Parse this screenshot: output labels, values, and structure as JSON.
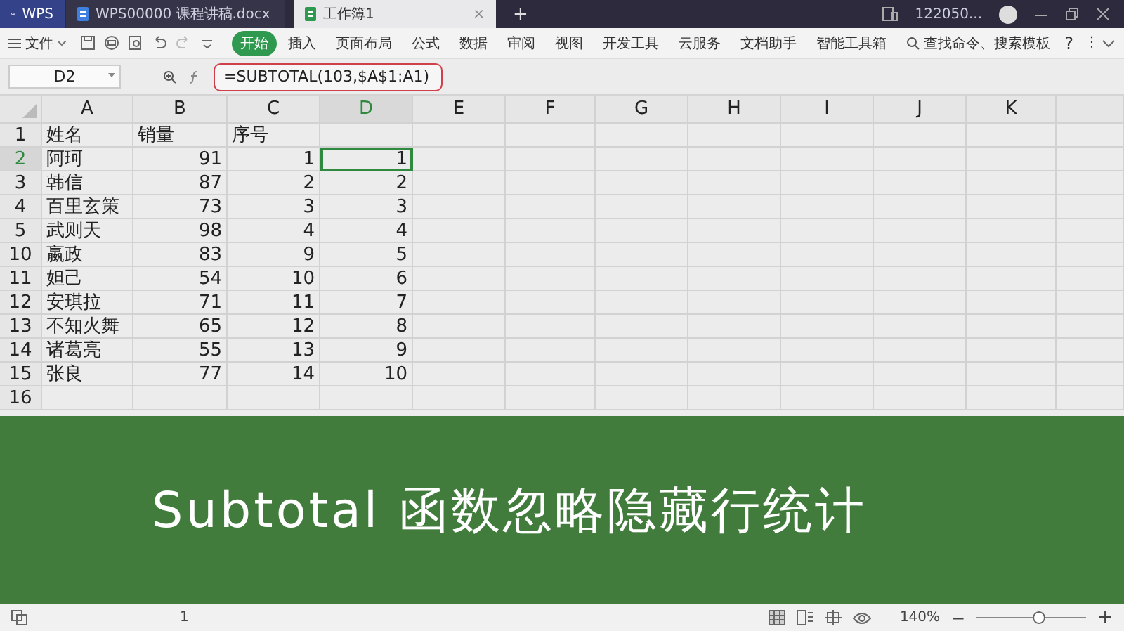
{
  "title_bar": {
    "app_tab": "WPS",
    "tabs": [
      {
        "label": "WPS00000 课程讲稿.docx",
        "kind": "doc",
        "selected": false
      },
      {
        "label": "工作簿1",
        "kind": "sheet",
        "selected": true,
        "close": "×"
      }
    ],
    "new_tab": "+",
    "user": "122050..."
  },
  "ribbon": {
    "file_menu": "文件",
    "tabs": [
      {
        "label": "开始",
        "selected": true
      },
      {
        "label": "插入",
        "selected": false
      },
      {
        "label": "页面布局",
        "selected": false
      },
      {
        "label": "公式",
        "selected": false
      },
      {
        "label": "数据",
        "selected": false
      },
      {
        "label": "审阅",
        "selected": false
      },
      {
        "label": "视图",
        "selected": false
      },
      {
        "label": "开发工具",
        "selected": false
      },
      {
        "label": "云服务",
        "selected": false
      },
      {
        "label": "文档助手",
        "selected": false
      },
      {
        "label": "智能工具箱",
        "selected": false
      }
    ],
    "search": "查找命令、搜索模板",
    "help": "?",
    "more": "⋮"
  },
  "formula_bar": {
    "name_box": "D2",
    "formula": "=SUBTOTAL(103,$A$1:A1)",
    "highlighted": true
  },
  "sheet": {
    "columns": [
      {
        "label": "A",
        "selected": false
      },
      {
        "label": "B",
        "selected": false
      },
      {
        "label": "C",
        "selected": false
      },
      {
        "label": "D",
        "selected": true
      },
      {
        "label": "E",
        "selected": false
      },
      {
        "label": "F",
        "selected": false
      },
      {
        "label": "G",
        "selected": false
      },
      {
        "label": "H",
        "selected": false
      },
      {
        "label": "I",
        "selected": false
      },
      {
        "label": "J",
        "selected": false
      },
      {
        "label": "K",
        "selected": false
      }
    ],
    "rows": [
      {
        "number": "1",
        "selected": false,
        "cells": [
          "姓名",
          "销量",
          "序号"
        ]
      },
      {
        "number": "2",
        "selected": true,
        "cells": [
          "阿珂",
          "91",
          "1",
          "1"
        ]
      },
      {
        "number": "3",
        "selected": false,
        "cells": [
          "韩信",
          "87",
          "2",
          "2"
        ]
      },
      {
        "number": "4",
        "selected": false,
        "cells": [
          "百里玄策",
          "73",
          "3",
          "3"
        ]
      },
      {
        "number": "5",
        "selected": false,
        "cells": [
          "武则天",
          "98",
          "4",
          "4"
        ]
      },
      {
        "number": "10",
        "selected": false,
        "cells": [
          "嬴政",
          "83",
          "9",
          "5"
        ]
      },
      {
        "number": "11",
        "selected": false,
        "cells": [
          "妲己",
          "54",
          "10",
          "6"
        ]
      },
      {
        "number": "12",
        "selected": false,
        "cells": [
          "安琪拉",
          "71",
          "11",
          "7"
        ]
      },
      {
        "number": "13",
        "selected": false,
        "cells": [
          "不知火舞",
          "65",
          "12",
          "8"
        ]
      },
      {
        "number": "14",
        "selected": false,
        "cells": [
          "诸葛亮",
          "55",
          "13",
          "9"
        ]
      },
      {
        "number": "15",
        "selected": false,
        "cells": [
          "张良",
          "77",
          "14",
          "10"
        ]
      },
      {
        "number": "16",
        "selected": false
      }
    ]
  },
  "caption": "Subtotal 函数忽略隐藏行统计",
  "status_bar": {
    "page": "1",
    "zoom": "140%",
    "zoom_out": "−",
    "zoom_in": "+",
    "zoom_slider": {
      "level": 0.56
    }
  }
}
